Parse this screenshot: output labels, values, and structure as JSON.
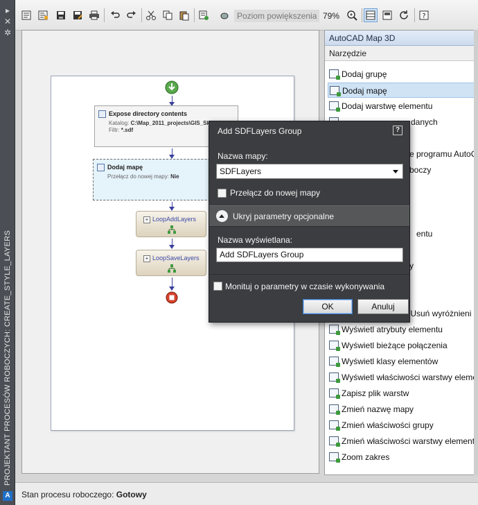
{
  "sidebar": {
    "vertical_title": "PROJEKTANT PROCESÓW ROBOCZYCH: CREATE_STYLE_LAYERS",
    "pin_glyph": "▸",
    "close_glyph": "✕",
    "settings_glyph": "✲"
  },
  "toolbar": {
    "zoom_label": "Poziom powiększenia",
    "zoom_value": "79%",
    "icons": [
      "properties-icon",
      "workflow-properties-icon",
      "save-icon",
      "save-as-icon",
      "print-icon",
      "undo-icon",
      "redo-icon",
      "cut-icon",
      "copy-icon",
      "paste-icon",
      "run-workflow-icon",
      "pan-icon",
      "zoom-icon",
      "grid-view-icon",
      "toolbox-icon",
      "refresh-icon",
      "help-icon"
    ]
  },
  "workflow": {
    "expose_node": {
      "title": "Expose directory contents",
      "catalog_label": "Katalog:",
      "catalog_value": "C:\\Map_2011_projects\\GIS_Sk",
      "filter_label": "Filtr:",
      "filter_value": "*.sdf"
    },
    "addmap_node": {
      "title": "Dodaj mapę",
      "switch_label": "Przełącz do nowej mapy:",
      "switch_value": "Nie"
    },
    "loop1": "LoopAddLayers",
    "loop2": "LoopSaveLayers"
  },
  "panel": {
    "title": "AutoCAD Map 3D",
    "subtitle": "Narzędzie",
    "items": [
      "Dodaj grupę",
      "Dodaj mapę",
      "Dodaj warstwę elementu",
      "danych",
      "e programu AutoC",
      "boczy",
      "entu",
      "y",
      "/Usuń wyróżnieni",
      "Wyświetl atrybuty elementu",
      "Wyświetl bieżące połączenia",
      "Wyświetl klasy elementów",
      "Wyświetl właściwości warstwy eleme",
      "Zapisz plik warstw",
      "Zmień nazwę mapy",
      "Zmień właściwości grupy",
      "Zmień właściwości warstwy element",
      "Zoom zakres"
    ]
  },
  "status": {
    "label": "Stan procesu roboczego:",
    "value": "Gotowy"
  },
  "dialog": {
    "title": "Add SDFLayers Group",
    "help": "?",
    "map_name_label": "Nazwa mapy:",
    "map_name_value": "SDFLayers",
    "switch_new_map": "Przełącz do nowej mapy",
    "optional_toggle": "Ukryj parametry opcjonalne",
    "display_name_label": "Nazwa wyświetlana:",
    "display_name_value": "Add SDFLayers Group",
    "prompt_runtime": "Monituj o parametry w czasie wykonywania",
    "ok": "OK",
    "cancel": "Anuluj"
  }
}
